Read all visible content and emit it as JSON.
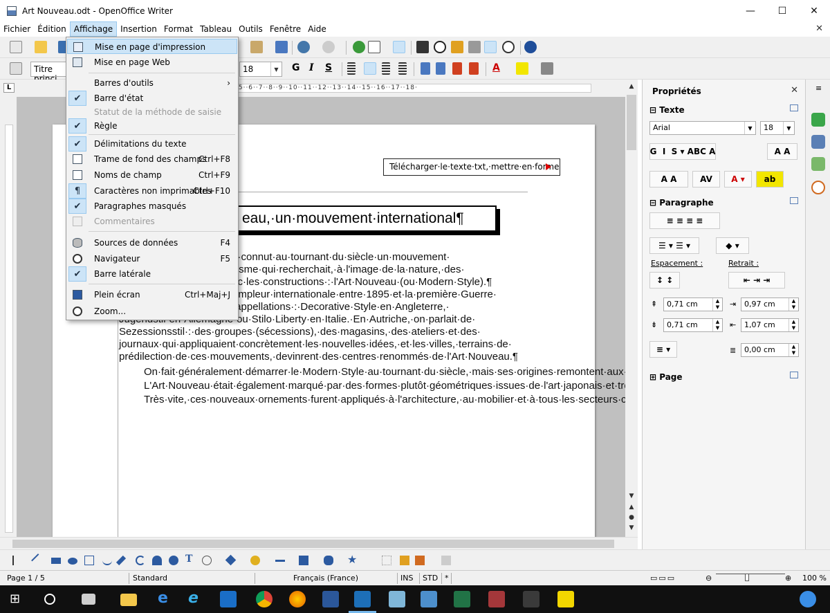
{
  "window": {
    "title": "Art Nouveau.odt - OpenOffice Writer",
    "minimize": "—",
    "maximize": "☐",
    "close": "✕"
  },
  "menubar": {
    "items": [
      "Fichier",
      "Édition",
      "Affichage",
      "Insertion",
      "Format",
      "Tableau",
      "Outils",
      "Fenêtre",
      "Aide"
    ],
    "close_doc": "✕"
  },
  "toolbar": {
    "para_style": "Titre princi",
    "font_size": "18"
  },
  "ruler": {
    "corner": "L",
    "scale": "·5··6··7··8··9··10··11··12··13··14··15··16··17··18·"
  },
  "view_menu": {
    "items": [
      {
        "label": "Mise en page d'impression",
        "shortcut": "",
        "icon": "page-icon"
      },
      {
        "label": "Mise en page Web",
        "shortcut": "",
        "icon": "web-page-icon"
      },
      {
        "label": "Barres d'outils",
        "shortcut": "›",
        "icon": ""
      },
      {
        "label": "Barre d'état",
        "shortcut": "",
        "icon": "checkmark-icon"
      },
      {
        "label": "Statut de la méthode de saisie",
        "shortcut": "",
        "icon": ""
      },
      {
        "label": "Règle",
        "shortcut": "",
        "icon": "checkmark-icon"
      },
      {
        "label": "Délimitations du texte",
        "shortcut": "",
        "icon": "checkmark-icon"
      },
      {
        "label": "Trame de fond des champs",
        "shortcut": "Ctrl+F8",
        "icon": "field-shading-icon"
      },
      {
        "label": "Noms de champ",
        "shortcut": "Ctrl+F9",
        "icon": "field-names-icon"
      },
      {
        "label": "Caractères non imprimables",
        "shortcut": "Ctrl+F10",
        "icon": "pilcrow-icon"
      },
      {
        "label": "Paragraphes masqués",
        "shortcut": "",
        "icon": "checkmark-icon"
      },
      {
        "label": "Commentaires",
        "shortcut": "",
        "icon": "comment-icon"
      },
      {
        "label": "Sources de données",
        "shortcut": "F4",
        "icon": "database-icon"
      },
      {
        "label": "Navigateur",
        "shortcut": "F5",
        "icon": "navigator-icon"
      },
      {
        "label": "Barre latérale",
        "shortcut": "",
        "icon": "checkmark-icon"
      },
      {
        "label": "Plein écran",
        "shortcut": "Ctrl+Maj+J",
        "icon": "fullscreen-icon"
      },
      {
        "label": "Zoom...",
        "shortcut": "",
        "icon": "zoom-icon"
      }
    ]
  },
  "document": {
    "textbox": "Télécharger·le·texte·txt,·mettre·en·forme",
    "heading": "eau,·un·mouvement·international¶",
    "paragraphs": [
      "ment,·connut·au·tournant·du·siècle·un·mouvement·",
      "storicisme·qui·recherchait,·à·l'image·de·la·nature,·des·",
      "d·avec·les·constructions·:·l'Art·Nouveau·(ou·Modern·Style).¶",
      "une·ampleur·internationale·entre·1895·et·la·première·Guerre·",
      "eurs·appellations·:·Decorative·Style·en·Angleterre,·",
      "Jugendstil·en·Allemagne·ou·Stilo·Liberty·en·Italie.·En·Autriche,·on·parlait·de·",
      "Sezessionsstil·:·des·groupes·(sécessions),·des·magasins,·des·ateliers·et·des·",
      "journaux·qui·appliquaient·concrètement·les·nouvelles·idées,·et·les·villes,·terrains·de·",
      "prédilection·de·ces·mouvements,·devinrent·des·centres·renommés·de·l'Art·Nouveau.¶"
    ],
    "para2": "On·fait·généralement·démarrer·le·Modern·Style·au·tournant·du·siècle,·mais·ses·origines·remontent·aux·années·1880.·On·en·trouve·en·effet·les·premières·manifestations·en·Angleterre,·dans·le·secteur·graphique,·dans·l'impression·comme·dans·l'édition.·Le·retour·à·la·nature·prôné·par·le·mouvement·Arts·and·Crafts·s'exprimait·ici·dans·des·lignes·aux·contours·organiques,·dans·des·formes·de·plantes,·des·tiges·de·fleurs·et·des·vrilles·stylisées,·utilisées·comme·décorations.·On·privilégiait·notamment·les·lis·et·les·nénuphars,·car·ils·renfermaient·aussi·une·valeur·symbolique.·Les·formes·étaient·asymétriques·et·semblaient·résulter·d'un·processus·naturel·de·création.¶",
    "para3": "L'Art·Nouveau·était·également·marqué·par·des·formes·plutôt·géométriques·issues·de·l'art·japonais·et·très·prisées·en·Angleterre.¶",
    "para4": "Très·vite,·ces·nouveaux·ornements·furent·appliqués·à·l'architecture,·au·mobilier·et·à·tous·les·secteurs·créatifs,·car·les·représentants·du·Modern·Style·voulaient·avant·"
  },
  "sidebar": {
    "title": "Propriétés",
    "close": "✕",
    "text_section": "Texte",
    "font": "Arial",
    "size": "18",
    "paragraph_section": "Paragraphe",
    "spacing_label": "Espacement :",
    "indent_label": "Retrait :",
    "spacing_above": "0,71 cm",
    "spacing_below": "0,71 cm",
    "indent_before": "0,97 cm",
    "indent_after": "1,07 cm",
    "first_line": "0,00 cm",
    "page_section": "Page"
  },
  "statusbar": {
    "page": "Page 1 / 5",
    "style": "Standard",
    "language": "Français (France)",
    "ins": "INS",
    "std": "STD",
    "star": "*",
    "zoom": "100 %",
    "zoom_minus": "⊖",
    "zoom_plus": "⊕"
  },
  "colors": {
    "menu_highlight": "#cce4f7",
    "menu_highlight_border": "#99c9ef",
    "taskbar": "#101010"
  }
}
